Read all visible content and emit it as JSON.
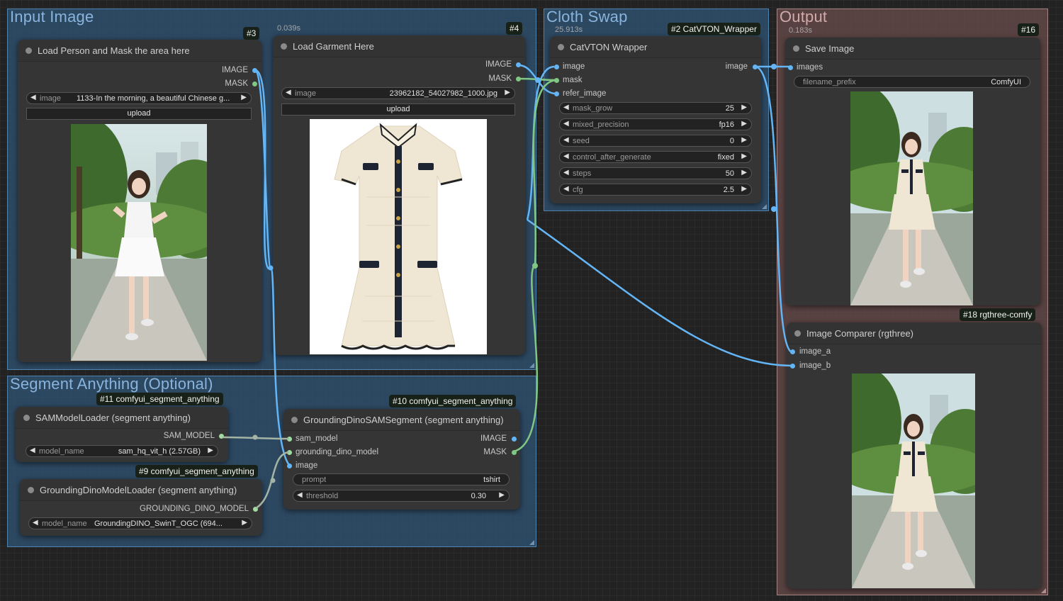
{
  "groups": {
    "input_image": "Input Image",
    "cloth_swap": "Cloth Swap",
    "output": "Output",
    "segment_anything": "Segment Anything (Optional)"
  },
  "colors": {
    "image_link": "#64b5f6",
    "mask_link": "#81c784",
    "group_blue": "#305678",
    "group_pink": "#6e4e4e"
  },
  "nodes": {
    "load_person": {
      "badge": "#3",
      "title": "Load Person and Mask the area here",
      "outputs": [
        "IMAGE",
        "MASK"
      ],
      "image_widget": {
        "label": "image",
        "value": "1133-In the morning, a beautiful Chinese g..."
      },
      "upload_label": "upload"
    },
    "load_garment": {
      "badge": "#4",
      "timing": "0.039s",
      "title": "Load Garment Here",
      "outputs": [
        "IMAGE",
        "MASK"
      ],
      "image_widget": {
        "label": "image",
        "value": "23962182_54027982_1000.jpg"
      },
      "upload_label": "upload"
    },
    "catvton": {
      "badge": "#2 CatVTON_Wrapper",
      "timing": "25.913s",
      "title": "CatVTON Wrapper",
      "inputs": [
        "image",
        "mask",
        "refer_image"
      ],
      "output": "image",
      "widgets": [
        {
          "label": "mask_grow",
          "value": "25"
        },
        {
          "label": "mixed_precision",
          "value": "fp16"
        },
        {
          "label": "seed",
          "value": "0"
        },
        {
          "label": "control_after_generate",
          "value": "fixed"
        },
        {
          "label": "steps",
          "value": "50"
        },
        {
          "label": "cfg",
          "value": "2.5"
        }
      ]
    },
    "save_image": {
      "badge": "#16",
      "timing": "0.183s",
      "title": "Save Image",
      "input": "images",
      "filename_prefix": {
        "label": "filename_prefix",
        "value": "ComfyUI"
      }
    },
    "image_comparer": {
      "badge": "#18 rgthree-comfy",
      "title": "Image Comparer (rgthree)",
      "inputs": [
        "image_a",
        "image_b"
      ]
    },
    "sam_loader": {
      "badge": "#11 comfyui_segment_anything",
      "title": "SAMModelLoader (segment anything)",
      "output": "SAM_MODEL",
      "model_widget": {
        "label": "model_name",
        "value": "sam_hq_vit_h (2.57GB)"
      }
    },
    "dino_loader": {
      "badge": "#9 comfyui_segment_anything",
      "title": "GroundingDinoModelLoader (segment anything)",
      "output": "GROUNDING_DINO_MODEL",
      "model_widget": {
        "label": "model_name",
        "value": "GroundingDINO_SwinT_OGC (694..."
      }
    },
    "dino_sam_segment": {
      "badge": "#10 comfyui_segment_anything",
      "title": "GroundingDinoSAMSegment (segment anything)",
      "inputs": [
        "sam_model",
        "grounding_dino_model",
        "image"
      ],
      "outputs": [
        "IMAGE",
        "MASK"
      ],
      "prompt": {
        "label": "prompt",
        "value": "tshirt"
      },
      "threshold": {
        "label": "threshold",
        "value": "0.30"
      }
    }
  }
}
